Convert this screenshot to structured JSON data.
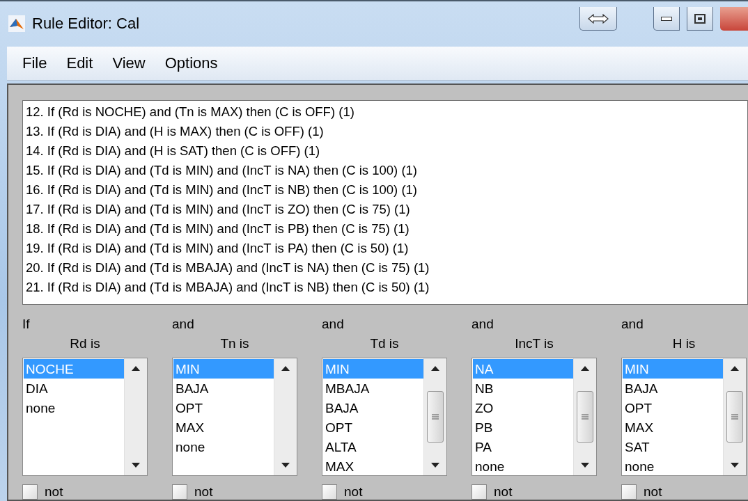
{
  "window": {
    "title": "Rule Editor: Cal"
  },
  "menu": [
    "File",
    "Edit",
    "View",
    "Options"
  ],
  "rules": [
    "12. If (Rd is NOCHE) and (Tn is MAX) then (C is OFF) (1)",
    "13. If (Rd is DIA) and (H is MAX) then (C is OFF) (1)",
    "14. If (Rd is DIA) and (H is SAT) then (C is OFF) (1)",
    "15. If (Rd is DIA) and (Td is MIN) and (IncT is NA) then (C is 100) (1)",
    "16. If (Rd is DIA) and (Td is MIN) and (IncT is NB) then (C is 100) (1)",
    "17. If (Rd is DIA) and (Td is MIN) and (IncT is ZO) then (C is 75) (1)",
    "18. If (Rd is DIA) and (Td is MIN) and (IncT is PB) then (C is 75) (1)",
    "19. If (Rd is DIA) and (Td is MIN) and (IncT is PA) then (C is 50) (1)",
    "20. If (Rd is DIA) and (Td is MBAJA) and (IncT is NA) then (C is 75) (1)",
    "21. If (Rd is DIA) and (Td is MBAJA) and (IncT is NB) then (C is 50) (1)"
  ],
  "inputs": [
    {
      "connector": "If",
      "label": "Rd is",
      "not_label": "not",
      "not_checked": false,
      "items": [
        {
          "text": "NOCHE",
          "selected": true
        },
        {
          "text": "DIA",
          "selected": false
        },
        {
          "text": "none",
          "selected": false
        }
      ]
    },
    {
      "connector": "and",
      "label": "Tn is",
      "not_label": "not",
      "not_checked": false,
      "items": [
        {
          "text": "MIN",
          "selected": true
        },
        {
          "text": "BAJA",
          "selected": false
        },
        {
          "text": "OPT",
          "selected": false
        },
        {
          "text": "MAX",
          "selected": false
        },
        {
          "text": "none",
          "selected": false
        }
      ]
    },
    {
      "connector": "and",
      "label": "Td is",
      "not_label": "not",
      "not_checked": false,
      "items": [
        {
          "text": "MIN",
          "selected": true
        },
        {
          "text": "MBAJA",
          "selected": false
        },
        {
          "text": "BAJA",
          "selected": false
        },
        {
          "text": "OPT",
          "selected": false
        },
        {
          "text": "ALTA",
          "selected": false
        },
        {
          "text": "MAX",
          "selected": false
        }
      ]
    },
    {
      "connector": "and",
      "label": "IncT is",
      "not_label": "not",
      "not_checked": false,
      "items": [
        {
          "text": "NA",
          "selected": true
        },
        {
          "text": "NB",
          "selected": false
        },
        {
          "text": "ZO",
          "selected": false
        },
        {
          "text": "PB",
          "selected": false
        },
        {
          "text": "PA",
          "selected": false
        },
        {
          "text": "none",
          "selected": false
        }
      ]
    },
    {
      "connector": "and",
      "label": "H is",
      "not_label": "not",
      "not_checked": false,
      "items": [
        {
          "text": "MIN",
          "selected": true
        },
        {
          "text": "BAJA",
          "selected": false
        },
        {
          "text": "OPT",
          "selected": false
        },
        {
          "text": "MAX",
          "selected": false
        },
        {
          "text": "SAT",
          "selected": false
        },
        {
          "text": "none",
          "selected": false
        }
      ]
    }
  ]
}
